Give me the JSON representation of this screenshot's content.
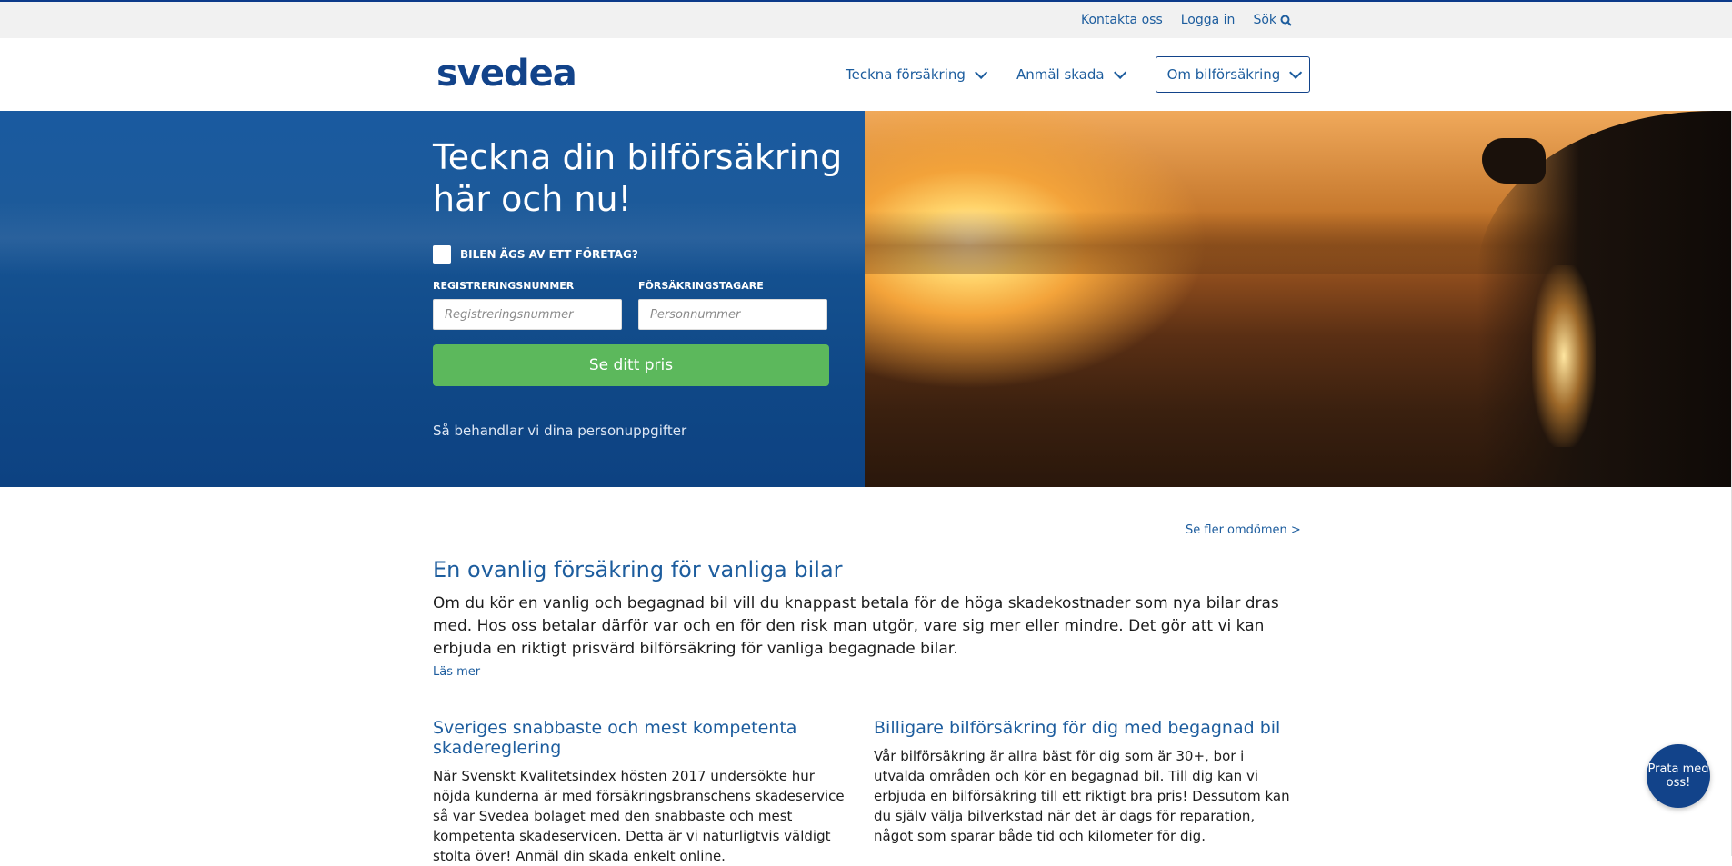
{
  "util_bar": {
    "contact": "Kontakta oss",
    "login": "Logga in",
    "search": "Sök"
  },
  "brand": {
    "logo_text": "svedea"
  },
  "nav": {
    "items": [
      "Teckna försäkring",
      "Anmäl skada",
      "Om bilförsäkring"
    ]
  },
  "hero": {
    "title": "Teckna din bilförsäkring här och nu!",
    "company_checkbox_label": "BILEN ÄGS AV ETT FÖRETAG?",
    "reg_label": "REGISTRERINGSNUMMER",
    "reg_placeholder": "Registreringsnummer",
    "holder_label": "FÖRSÄKRINGSTAGARE",
    "holder_placeholder": "Personnummer",
    "cta": "Se ditt pris",
    "privacy_link": "Så behandlar vi dina personuppgifter"
  },
  "content": {
    "reviews_link": "Se fler omdömen >",
    "section_title": "En ovanlig försäkring för vanliga bilar",
    "section_body": "Om du kör en vanlig och begagnad bil vill du knappast betala för de höga skadekostnader som nya bilar dras med. Hos oss betalar därför var och en för den risk man utgör, vare sig mer eller mindre. Det gör att vi kan erbjuda en riktigt prisvärd bilförsäkring för vanliga begagnade bilar.",
    "read_more": "Läs mer",
    "col1_title": "Sveriges snabbaste och mest kompetenta skadereglering",
    "col1_body": "När Svenskt Kvalitetsindex hösten 2017 undersökte hur nöjda kunderna är med försäkringsbranschens skadeservice så var Svedea bolaget med den snabbaste och mest kompetenta skadeservicen. Detta är vi naturligtvis väldigt stolta över! Anmäl din skada enkelt online.",
    "col2_title": "Billigare bilförsäkring för dig med begagnad bil",
    "col2_body": "Vår bilförsäkring är allra bäst för dig som är 30+, bor i utvalda områden och kör en begagnad bil. Till dig kan vi erbjuda en bilförsäkring till ett riktigt bra pris! Dessutom kan du själv välja bilverkstad när det är dags för reparation, något som sparar både tid och kilometer för dig."
  },
  "chat": {
    "label": "Prata med oss!"
  },
  "colors": {
    "brand_blue": "#12438a",
    "link_blue": "#1d5d9e",
    "cta_green": "#5cb85c"
  }
}
